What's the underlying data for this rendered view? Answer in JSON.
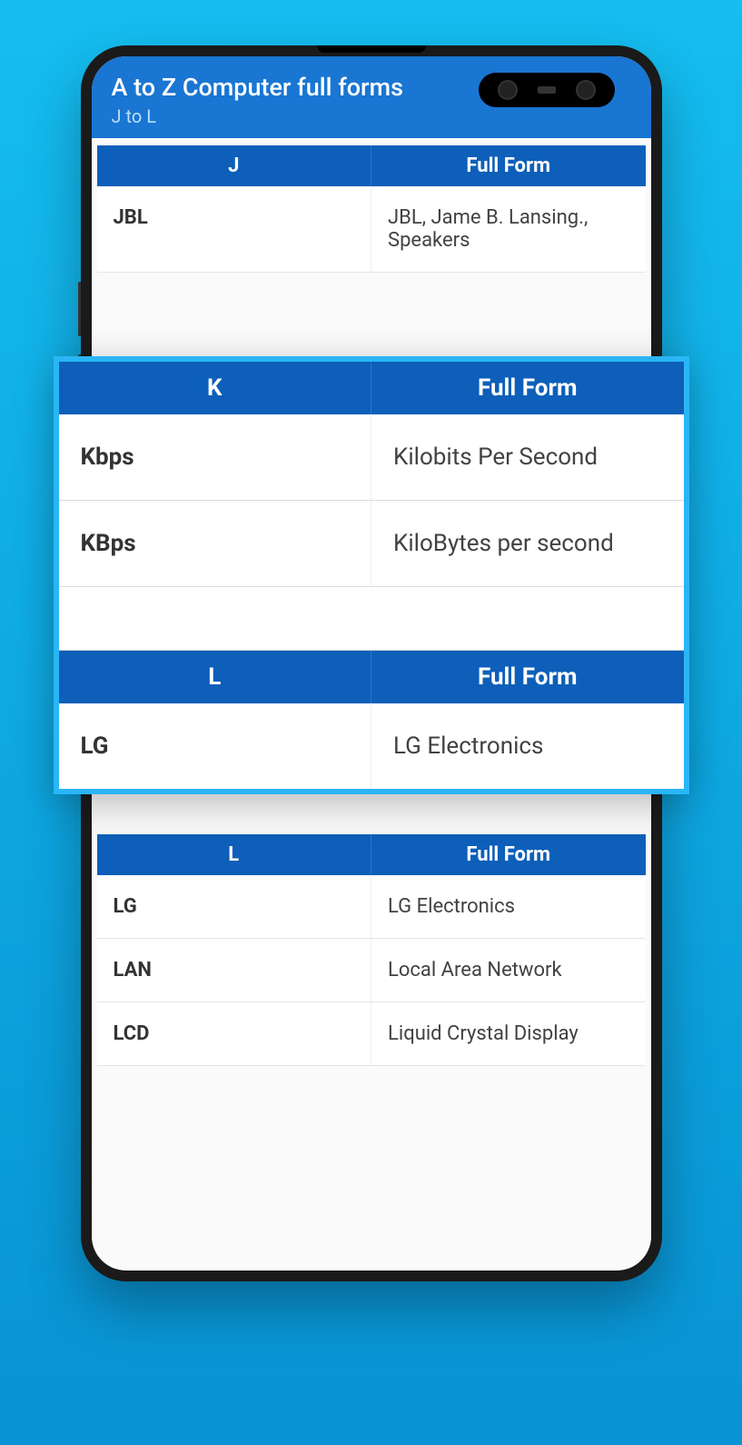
{
  "header": {
    "title": "A to Z Computer full forms",
    "subtitle": "J to L"
  },
  "sectionJ": {
    "col1": "J",
    "col2": "Full Form",
    "rows": [
      {
        "abbr": "JBL",
        "full": "JBL, Jame B. Lansing., Speakers"
      }
    ]
  },
  "sectionL_bg": {
    "col1": "L",
    "col2": "Full Form",
    "rows": [
      {
        "abbr": "LG",
        "full": "LG Electronics"
      },
      {
        "abbr": "LAN",
        "full": "Local Area Network"
      },
      {
        "abbr": "LCD",
        "full": "Liquid Crystal Display"
      }
    ]
  },
  "overlay": {
    "sectionK": {
      "col1": "K",
      "col2": "Full Form",
      "rows": [
        {
          "abbr": "Kbps",
          "full": "Kilobits Per Second"
        },
        {
          "abbr": "KBps",
          "full": "KiloBytes per second"
        }
      ]
    },
    "sectionL": {
      "col1": "L",
      "col2": "Full Form",
      "rows": [
        {
          "abbr": "LG",
          "full": "LG Electronics"
        }
      ]
    }
  }
}
